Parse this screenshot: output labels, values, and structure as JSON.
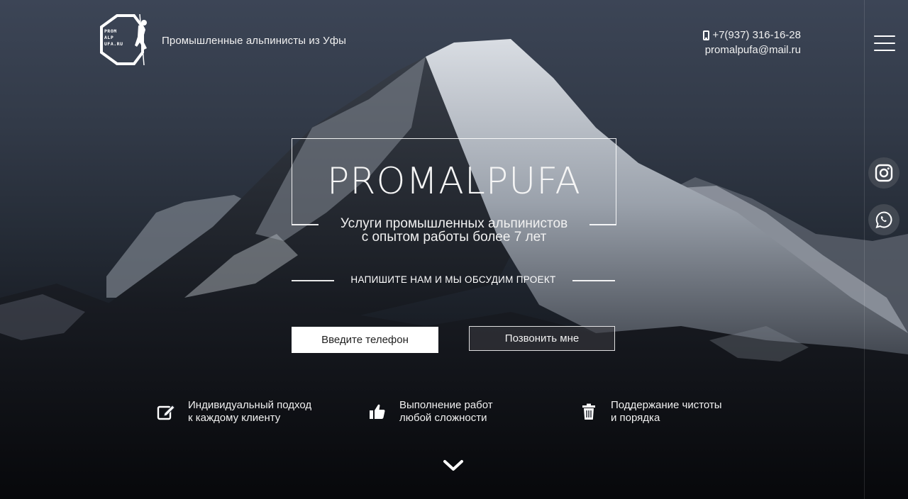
{
  "header": {
    "logo_lines": [
      "PROM",
      "ALP",
      "UFA.RU"
    ],
    "tagline": "Промышленные альпинисты из Уфы",
    "phone": "+7(937) 316-16-28",
    "email": "promalpufa@mail.ru"
  },
  "sidebar": {
    "menu_icon": "hamburger-menu-icon",
    "social": [
      {
        "icon": "instagram-icon"
      },
      {
        "icon": "whatsapp-icon"
      }
    ]
  },
  "hero": {
    "brand": "PROMALPUFA",
    "subtitle_line1": "Услуги промышленных альпинистов",
    "subtitle_line2": "с опытом работы более 7 лет",
    "cta_text": "НАПИШИТЕ НАМ И МЫ ОБСУДИМ ПРОЕКТ",
    "phone_placeholder": "Введите телефон",
    "call_button": "Позвонить мне"
  },
  "features": [
    {
      "icon": "edit-icon",
      "line1": "Индивидуальный подход",
      "line2": "к каждому клиенту"
    },
    {
      "icon": "thumbs-up-icon",
      "line1": "Выполнение работ",
      "line2": "любой сложности"
    },
    {
      "icon": "trash-icon",
      "line1": "Поддержание чистоты",
      "line2": "и порядка"
    }
  ],
  "colors": {
    "accent": "#ffffff",
    "sky": "#3c4556",
    "ground": "#0c0e13"
  }
}
